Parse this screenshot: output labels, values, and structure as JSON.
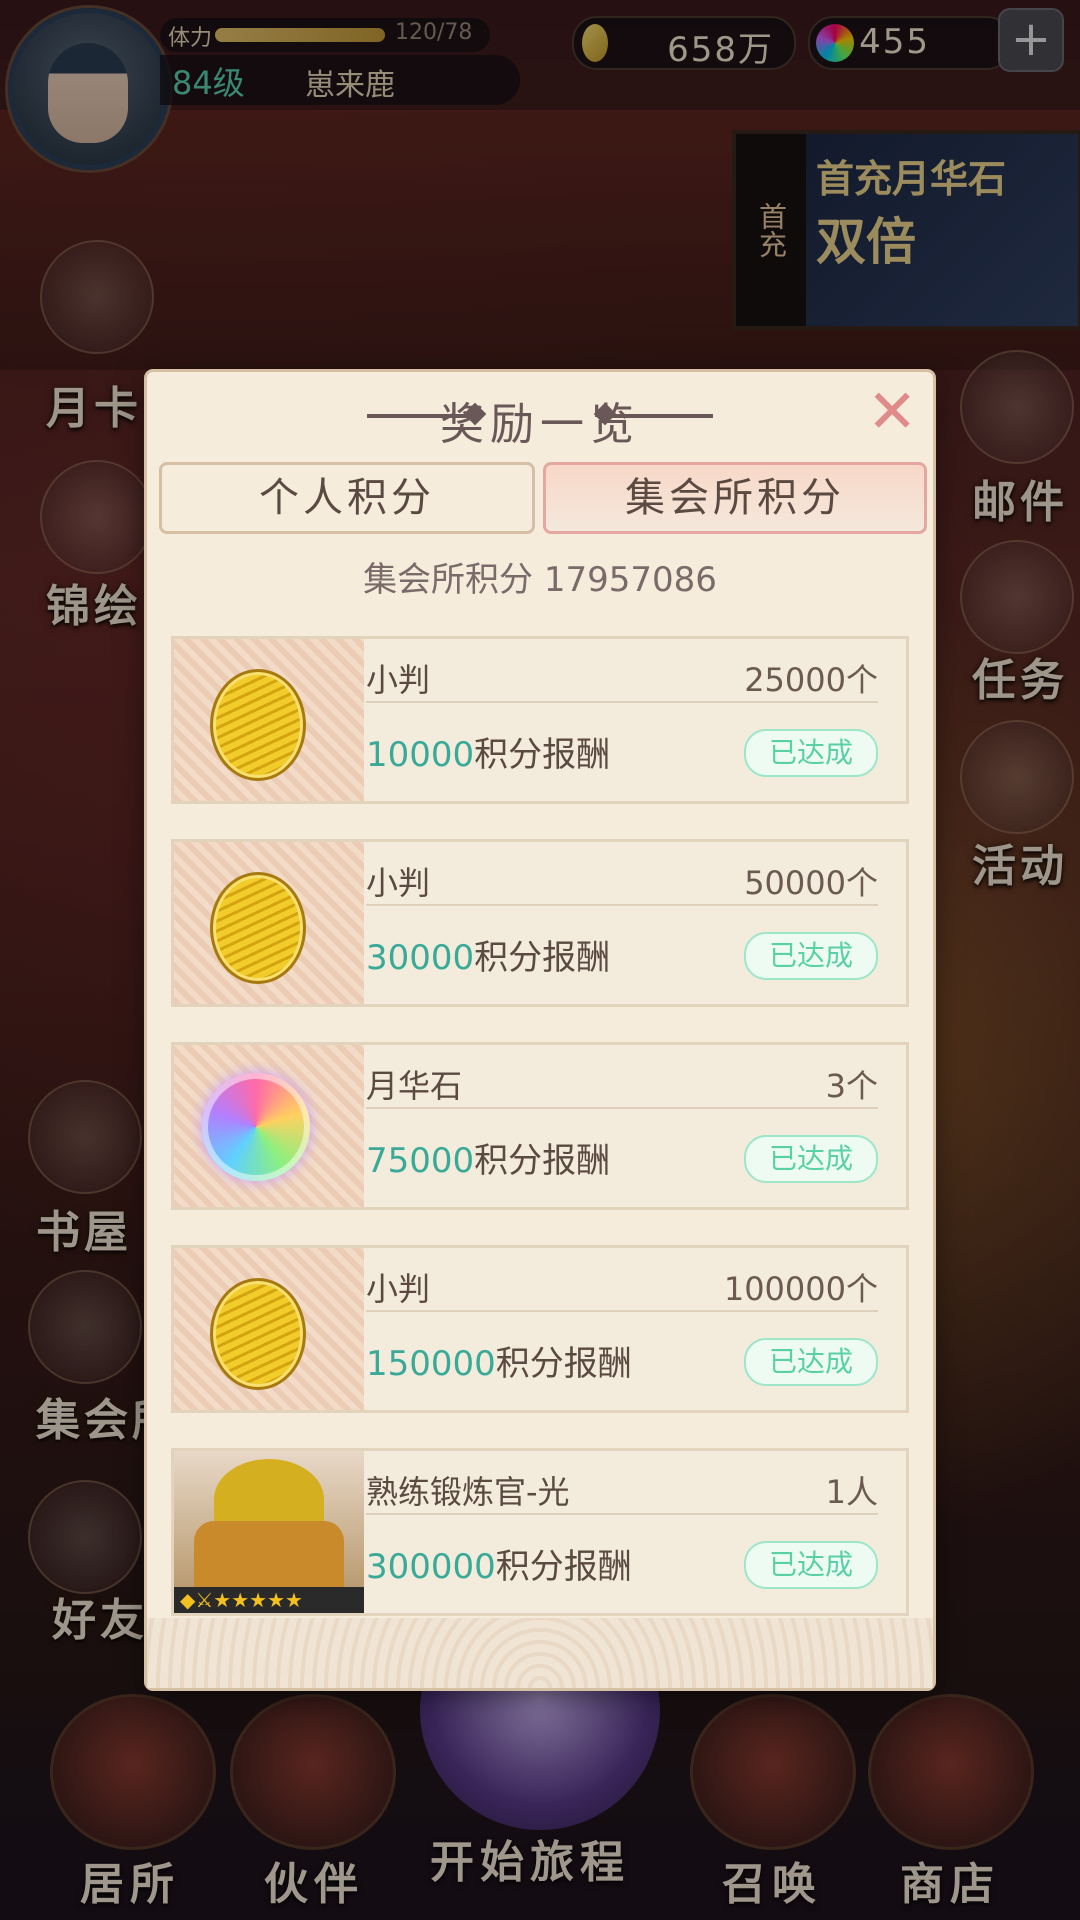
{
  "hud": {
    "stamina_label": "体力",
    "stamina_value": "120/78",
    "stamina_fraction": 0.65,
    "level": "84级",
    "username": "崽来鹿",
    "coins": "658万",
    "gems": "455",
    "plus": "+"
  },
  "promo": {
    "side": "首充",
    "title": "首充月华石",
    "subtitle": "双倍"
  },
  "side_menu": {
    "left": [
      "月卡",
      "锦绘",
      "书屋",
      "集会所",
      "好友"
    ],
    "right": [
      "邮件",
      "任务",
      "活动"
    ]
  },
  "bottom_nav": [
    "居所",
    "伙伴",
    "开始旅程",
    "召唤",
    "商店"
  ],
  "modal": {
    "title": "奖励一览",
    "close": "✕",
    "tabs": [
      "个人积分",
      "集会所积分"
    ],
    "active_tab": 1,
    "score_label": "集会所积分 17957086",
    "rewards": [
      {
        "icon": "coin-icon",
        "name": "小判",
        "qty": "25000个",
        "points": "10000",
        "suffix": "积分报酬",
        "status": "已达成"
      },
      {
        "icon": "coin-icon",
        "name": "小判",
        "qty": "50000个",
        "points": "30000",
        "suffix": "积分报酬",
        "status": "已达成"
      },
      {
        "icon": "gem-icon",
        "name": "月华石",
        "qty": "3个",
        "points": "75000",
        "suffix": "积分报酬",
        "status": "已达成"
      },
      {
        "icon": "coin-icon",
        "name": "小判",
        "qty": "100000个",
        "points": "150000",
        "suffix": "积分报酬",
        "status": "已达成"
      },
      {
        "icon": "character-portrait",
        "name": "熟练锻炼官-光",
        "qty": "1人",
        "points": "300000",
        "suffix": "积分报酬",
        "status": "已达成",
        "stars": "◆⚔★★★★★"
      }
    ]
  }
}
